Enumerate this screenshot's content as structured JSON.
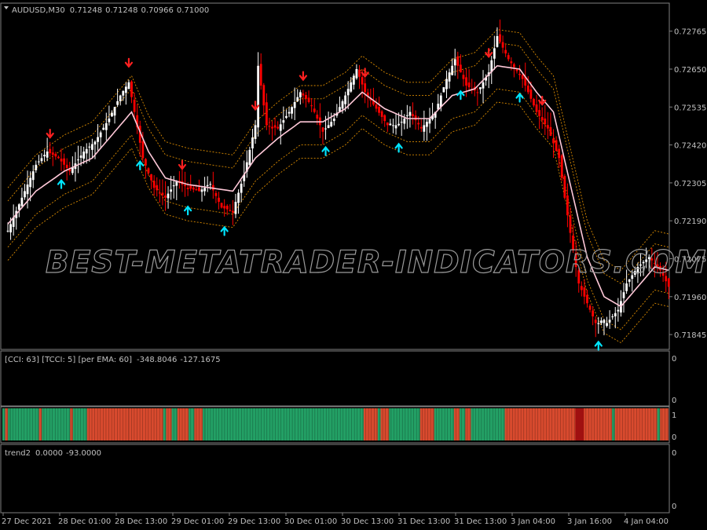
{
  "chart_data": {
    "type": "candlestick",
    "symbol_header": "AUDUSD,M30",
    "ohlc": [
      "0.71248",
      "0.71248",
      "0.70966",
      "0.71000"
    ],
    "ylim": [
      0.718,
      0.7285
    ],
    "price_ticks": [
      "0.72765",
      "0.72650",
      "0.72535",
      "0.72420",
      "0.72305",
      "0.72190",
      "0.72075",
      "0.71960",
      "0.71845"
    ],
    "time_ticks": [
      "27 Dec 2021",
      "28 Dec 01:00",
      "28 Dec 13:00",
      "29 Dec 01:00",
      "29 Dec 13:00",
      "30 Dec 01:00",
      "30 Dec 13:00",
      "31 Dec 13:00",
      "31 Dec 13:00",
      "3 Jan 04:00",
      "3 Jan 16:00",
      "4 Jan 04:00"
    ],
    "path": [
      [
        0,
        0.7216
      ],
      [
        5,
        0.7226
      ],
      [
        10,
        0.7236
      ],
      [
        14,
        0.724
      ],
      [
        18,
        0.7238
      ],
      [
        22,
        0.7234
      ],
      [
        27,
        0.724
      ],
      [
        31,
        0.7243
      ],
      [
        36,
        0.725
      ],
      [
        40,
        0.7257
      ],
      [
        43,
        0.7261
      ],
      [
        45,
        0.7252
      ],
      [
        48,
        0.7238
      ],
      [
        52,
        0.7229
      ],
      [
        56,
        0.7226
      ],
      [
        60,
        0.7231
      ],
      [
        64,
        0.7229
      ],
      [
        68,
        0.7228
      ],
      [
        72,
        0.723
      ],
      [
        76,
        0.7223
      ],
      [
        80,
        0.7222
      ],
      [
        84,
        0.7233
      ],
      [
        88,
        0.7248
      ],
      [
        89,
        0.7266
      ],
      [
        92,
        0.7248
      ],
      [
        96,
        0.7247
      ],
      [
        100,
        0.7252
      ],
      [
        104,
        0.7258
      ],
      [
        108,
        0.7254
      ],
      [
        112,
        0.7246
      ],
      [
        116,
        0.725
      ],
      [
        120,
        0.7257
      ],
      [
        124,
        0.7265
      ],
      [
        127,
        0.7258
      ],
      [
        131,
        0.7253
      ],
      [
        135,
        0.7248
      ],
      [
        139,
        0.7248
      ],
      [
        143,
        0.7252
      ],
      [
        147,
        0.7247
      ],
      [
        152,
        0.7252
      ],
      [
        156,
        0.7262
      ],
      [
        159,
        0.7268
      ],
      [
        163,
        0.726
      ],
      [
        167,
        0.7258
      ],
      [
        171,
        0.7264
      ],
      [
        174,
        0.7275
      ],
      [
        178,
        0.7268
      ],
      [
        183,
        0.7262
      ],
      [
        188,
        0.7252
      ],
      [
        192,
        0.7247
      ],
      [
        196,
        0.7238
      ],
      [
        198,
        0.7226
      ],
      [
        201,
        0.721
      ],
      [
        203,
        0.72
      ],
      [
        206,
        0.7194
      ],
      [
        209,
        0.7188
      ],
      [
        213,
        0.7188
      ],
      [
        217,
        0.7192
      ],
      [
        220,
        0.72
      ],
      [
        224,
        0.7205
      ],
      [
        228,
        0.7208
      ],
      [
        232,
        0.7204
      ],
      [
        235,
        0.7199
      ]
    ],
    "ema_path": [
      [
        0,
        0.7218
      ],
      [
        10,
        0.7228
      ],
      [
        20,
        0.7234
      ],
      [
        30,
        0.7238
      ],
      [
        38,
        0.7246
      ],
      [
        44,
        0.7252
      ],
      [
        50,
        0.724
      ],
      [
        56,
        0.7232
      ],
      [
        64,
        0.723
      ],
      [
        72,
        0.7229
      ],
      [
        80,
        0.7228
      ],
      [
        88,
        0.7238
      ],
      [
        96,
        0.7244
      ],
      [
        104,
        0.7249
      ],
      [
        112,
        0.7249
      ],
      [
        120,
        0.7253
      ],
      [
        126,
        0.7258
      ],
      [
        134,
        0.7253
      ],
      [
        142,
        0.725
      ],
      [
        150,
        0.725
      ],
      [
        158,
        0.7257
      ],
      [
        166,
        0.7259
      ],
      [
        174,
        0.7266
      ],
      [
        182,
        0.7265
      ],
      [
        188,
        0.7258
      ],
      [
        194,
        0.7252
      ],
      [
        200,
        0.723
      ],
      [
        206,
        0.7208
      ],
      [
        212,
        0.7196
      ],
      [
        218,
        0.7193
      ],
      [
        224,
        0.7199
      ],
      [
        230,
        0.7205
      ],
      [
        235,
        0.7204
      ]
    ],
    "band_offsets": [
      -0.0011,
      -0.0007,
      0.0007,
      0.0011
    ],
    "n_bars": 236,
    "sell_signals": [
      15,
      43,
      62,
      88,
      105,
      127,
      171,
      190
    ],
    "buy_signals": [
      19,
      47,
      64,
      77,
      113,
      139,
      161,
      182,
      210
    ],
    "cci_label": "[CCI: 63] [TCCI: 5] [per EMA: 60]",
    "cci_values": [
      "-348.8046",
      "-127.1675"
    ],
    "cci_axis": [
      "0",
      "0"
    ],
    "color_strip_axis": [
      "1",
      "0"
    ],
    "color_strip": [
      [
        0,
        1,
        "green"
      ],
      [
        1,
        2,
        "red"
      ],
      [
        2,
        3,
        "green"
      ],
      [
        3,
        13,
        "green"
      ],
      [
        13,
        14,
        "red"
      ],
      [
        14,
        24,
        "green"
      ],
      [
        24,
        25,
        "red"
      ],
      [
        25,
        30,
        "green"
      ],
      [
        30,
        45,
        "red"
      ],
      [
        45,
        57,
        "red"
      ],
      [
        57,
        58,
        "green"
      ],
      [
        58,
        60,
        "red"
      ],
      [
        60,
        62,
        "green"
      ],
      [
        62,
        66,
        "red"
      ],
      [
        66,
        68,
        "green"
      ],
      [
        68,
        71,
        "red"
      ],
      [
        71,
        72,
        "green"
      ],
      [
        72,
        128,
        "green"
      ],
      [
        128,
        133,
        "red"
      ],
      [
        133,
        134,
        "green"
      ],
      [
        134,
        137,
        "red"
      ],
      [
        137,
        148,
        "green"
      ],
      [
        148,
        153,
        "red"
      ],
      [
        153,
        160,
        "green"
      ],
      [
        160,
        162,
        "red"
      ],
      [
        162,
        164,
        "green"
      ],
      [
        164,
        166,
        "red"
      ],
      [
        166,
        178,
        "green"
      ],
      [
        178,
        216,
        "red"
      ],
      [
        216,
        217,
        "green"
      ],
      [
        217,
        232,
        "red"
      ],
      [
        232,
        233,
        "green"
      ],
      [
        233,
        236,
        "red"
      ]
    ],
    "trend_label": "trend2",
    "trend_values": [
      "0.0000",
      "-93.0000"
    ],
    "trend_axis": [
      "0",
      "0"
    ],
    "colors": {
      "background": "#000000",
      "bull": "#ffffff",
      "bear": "#ff0000",
      "ema": "#ffc8d8",
      "band": "#d98a00",
      "sell_arrow": "#ff2020",
      "buy_arrow": "#00e5ff",
      "strip_green": "#23a065",
      "strip_red": "#d84a2e",
      "strip_dark": "#a01010"
    }
  },
  "watermark": "BEST-METATRADER-INDICATORS.COM"
}
